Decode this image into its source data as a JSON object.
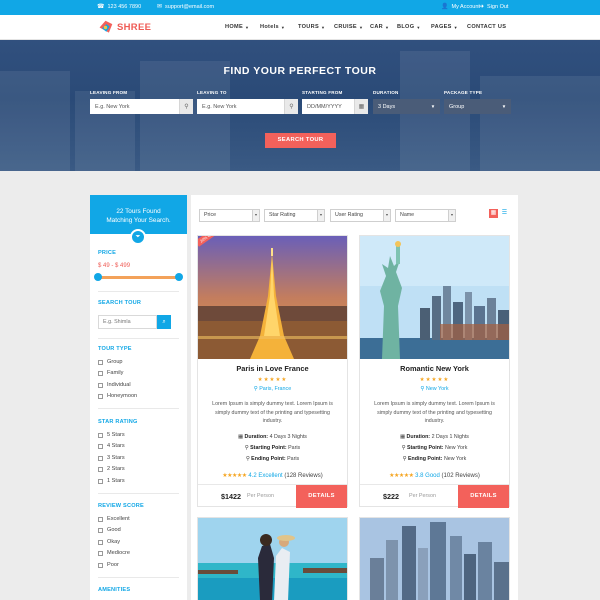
{
  "topbar": {
    "phone": "123 456 7890",
    "email": "support@email.com",
    "account": "My Account",
    "signout": "Sign Out"
  },
  "nav": {
    "logo": "SHREE",
    "items": [
      {
        "label": "HOME"
      },
      {
        "label": "Hotels"
      },
      {
        "label": "TOURS"
      },
      {
        "label": "CRUISE"
      },
      {
        "label": "CAR"
      },
      {
        "label": "BLOG"
      },
      {
        "label": "PAGES"
      },
      {
        "label": "CONTACT US"
      }
    ]
  },
  "hero": {
    "title": "FIND YOUR PERFECT TOUR",
    "leaving_from_label": "LEAVING FROM",
    "leaving_from_placeholder": "E.g. New York",
    "leaving_to_label": "LEAVING TO",
    "leaving_to_placeholder": "E.g. New York",
    "start_label": "STARTING FROM",
    "start_placeholder": "DD/MM/YYYY",
    "duration_label": "DURATION",
    "duration_value": "3 Days",
    "package_label": "PACKAGE TYPE",
    "package_value": "Group",
    "search_button": "SEARCH TOUR"
  },
  "sidebar": {
    "found": "22 Tours Found",
    "found_line2": "Matching Your Search.",
    "price_title": "PRICE",
    "price_range": "$ 49 - $ 499",
    "price_slider": {
      "low_fraction": 0.0,
      "high_fraction": 1.0
    },
    "search_title": "SEARCH TOUR",
    "search_placeholder": "E.g. Shimla",
    "tour_type_title": "TOUR TYPE",
    "tour_types": [
      "Group",
      "Family",
      "Individual",
      "Honeymoon"
    ],
    "star_title": "STAR RATING",
    "stars": [
      "5 Stars",
      "4 Stars",
      "3 Stars",
      "2 Stars",
      "1 Stars"
    ],
    "review_title": "REVIEW SCORE",
    "reviews": [
      "Excellent",
      "Good",
      "Okay",
      "Mediocre",
      "Poor"
    ],
    "amenities_title": "AMENITIES"
  },
  "sort": {
    "price": "Price",
    "star": "Star Rating",
    "user": "User Rating",
    "name": "Name"
  },
  "cards": [
    {
      "ribbon": "20% OFF",
      "title": "Paris in Love France",
      "stars": "★★★★★",
      "location": "Paris, France",
      "desc": "Lorem Ipsum is simply dummy text. Lorem Ipsum is simply dummy text of the printing and typesetting industry.",
      "duration_label": "Duration:",
      "duration": "4 Days 3 Nights",
      "start_label": "Starting Point:",
      "start": "Paris",
      "end_label": "Ending Point:",
      "end": "Paris",
      "rating_stars": "★★★★★",
      "rating_text": "4.2 Excellent",
      "reviews": "(128 Reviews)",
      "price": "$1422",
      "per": "Per Person",
      "details": "DETAILS"
    },
    {
      "title": "Romantic New York",
      "stars": "★★★★★",
      "location": "New York",
      "desc": "Lorem Ipsum is simply dummy text. Lorem Ipsum is simply dummy text of the printing and typesetting industry.",
      "duration_label": "Duration:",
      "duration": "2 Days 1 Nights",
      "start_label": "Starting Point:",
      "start": "New York",
      "end_label": "Ending Point:",
      "end": "New York",
      "rating_stars": "★★★★★",
      "rating_text": "3.8 Good",
      "reviews": "(102 Reviews)",
      "price": "$222",
      "per": "Per Person",
      "details": "DETAILS"
    }
  ],
  "colors": {
    "accent": "#11a7e6",
    "cta": "#f3615b",
    "star": "#f5a623"
  }
}
